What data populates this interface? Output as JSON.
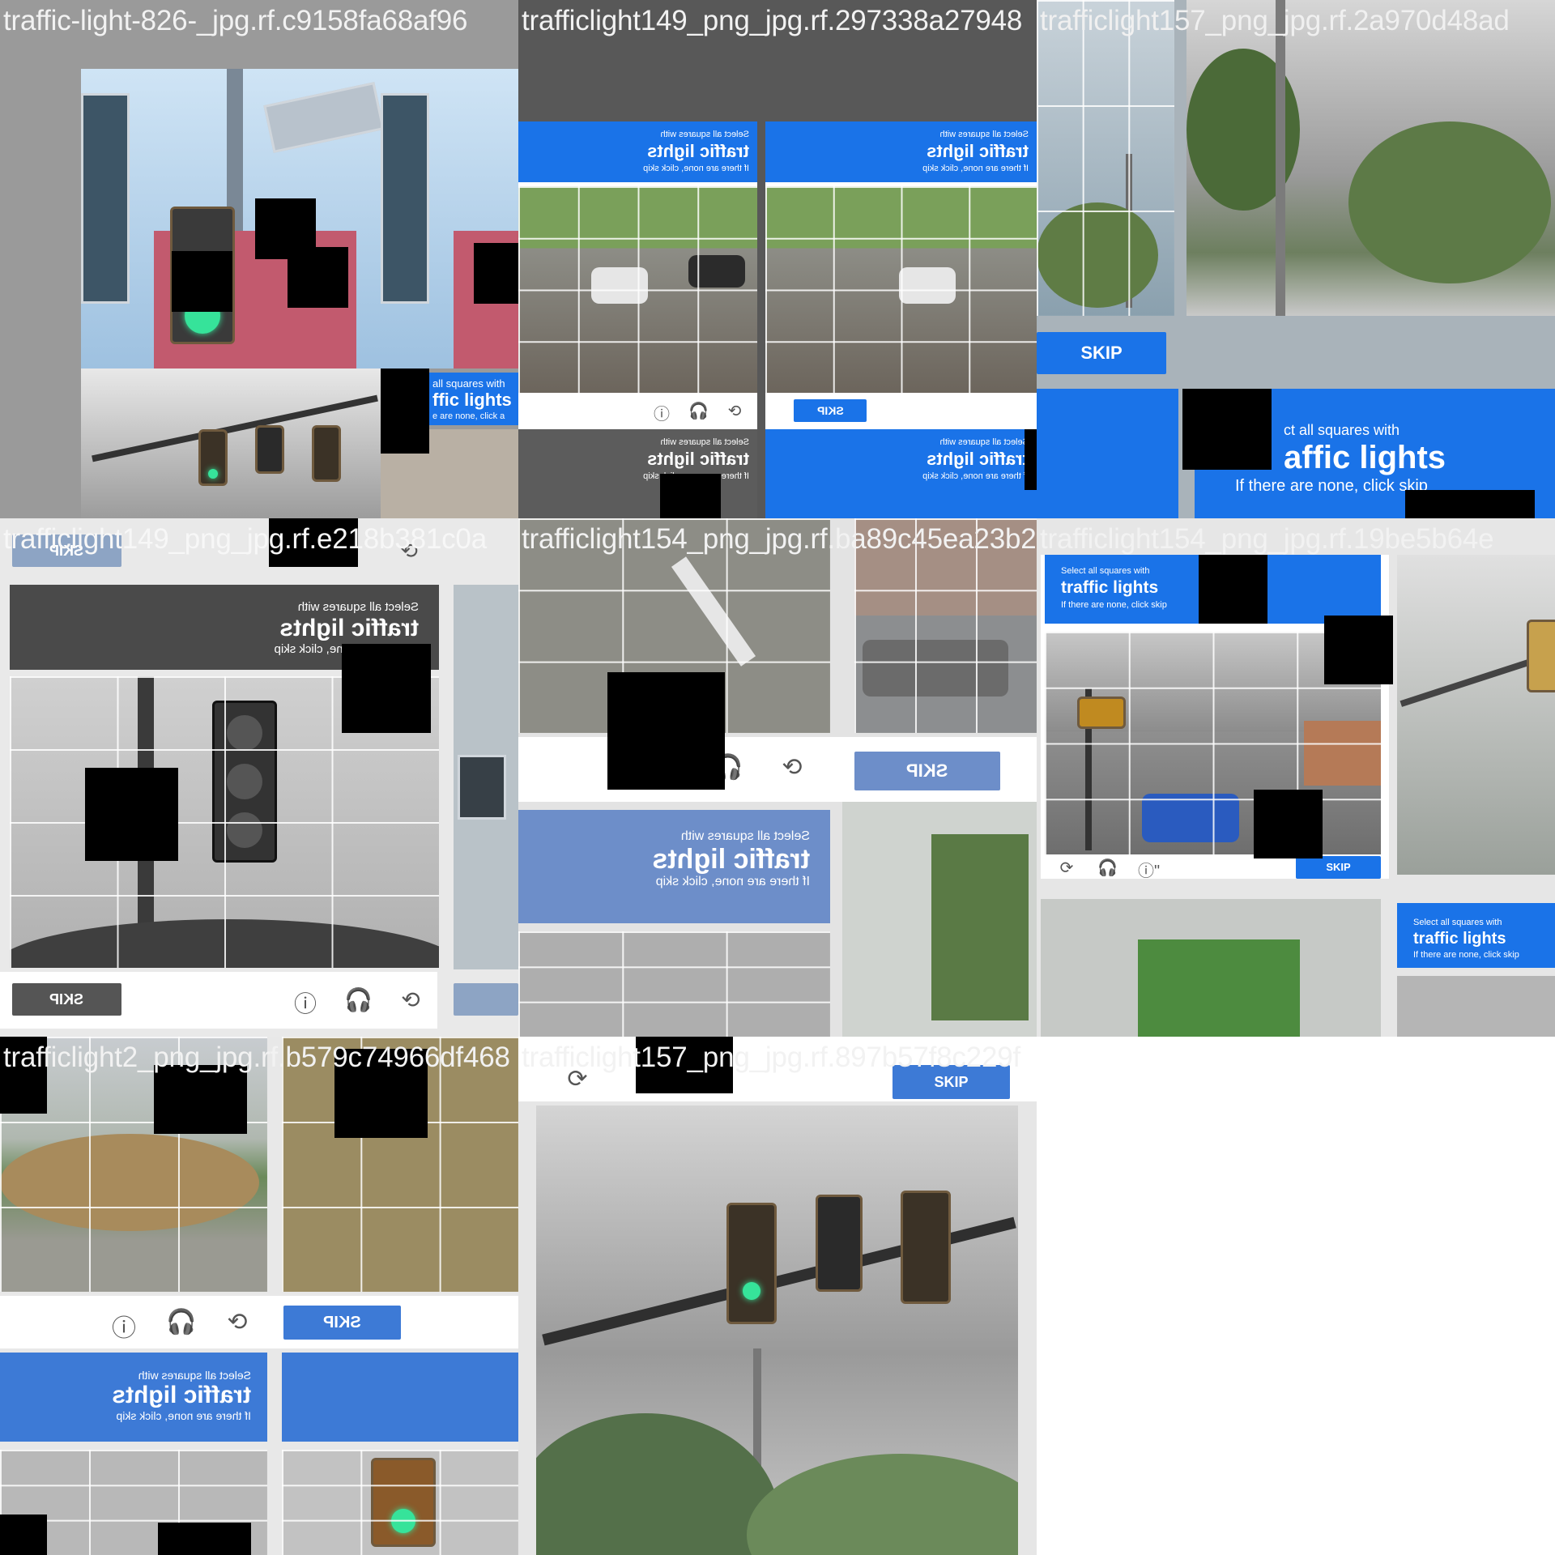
{
  "captcha": {
    "select_line": "Select all squares with",
    "target": "traffic lights",
    "skip_hint": "If there are none, click skip",
    "skip_button": "SKIP",
    "skip_button_small": "SKIP",
    "select_line_cropped": "ct all squares with",
    "target_cropped": "affic lights",
    "select_line_fragment": "all squares with",
    "target_fragment": "ffic lights",
    "skip_hint_fragment": "e are none, click a",
    "target_cropped_2": "traffic lights"
  },
  "tiles": [
    {
      "filename": "traffic-light-826-_jpg.rf.c9158fa68af96"
    },
    {
      "filename": "trafficlight149_png_jpg.rf.297338a27948"
    },
    {
      "filename": "trafficlight157_png_jpg.rf.2a970d48ad"
    },
    {
      "filename": "trafficlight149_png_jpg.rf.e218b381c0a"
    },
    {
      "filename": "trafficlight154_png_jpg.rf.ba89c45ea23b2"
    },
    {
      "filename": "trafficlight154_png_jpg.rf.19be5b64e"
    },
    {
      "filename": "trafficlight2_png_jpg.rf.b579c74966df468"
    },
    {
      "filename": "trafficlight157_png_jpg.rf.897b57f8c229f"
    }
  ],
  "icons": {
    "info": "info-icon",
    "audio": "headphones-icon",
    "reload": "reload-icon"
  },
  "colors": {
    "captcha_blue": "#1a73e8",
    "header_dark": "#4a4a4a",
    "redaction": "#000000",
    "filename_text": "#f2f2f2"
  }
}
